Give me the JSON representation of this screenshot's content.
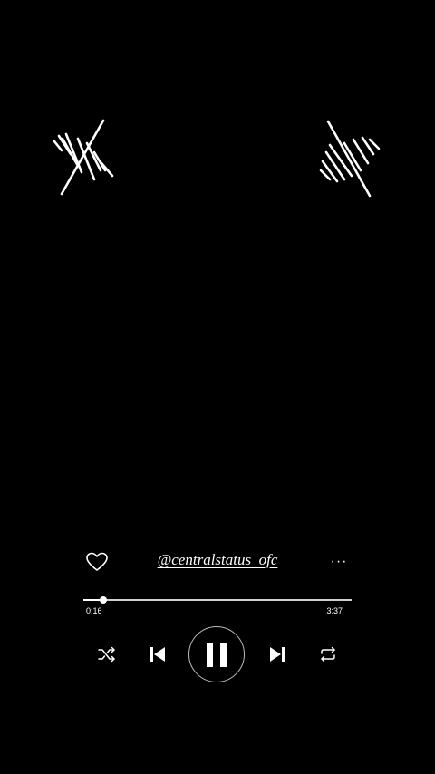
{
  "player": {
    "track_title": "@centralstatus_ofc",
    "more_label": "···",
    "elapsed": "0:16",
    "duration": "3:37",
    "progress_fraction": 0.0737,
    "is_playing": true,
    "liked": false
  },
  "colors": {
    "background": "#000000",
    "foreground": "#ffffff"
  },
  "icons": {
    "left_decoration": "sound-wave-icon",
    "right_decoration": "sound-wave-icon",
    "like": "heart-outline-icon",
    "more": "ellipsis-icon",
    "shuffle": "shuffle-icon",
    "previous": "skip-previous-icon",
    "play_pause": "pause-icon",
    "next": "skip-next-icon",
    "repeat": "repeat-icon"
  }
}
